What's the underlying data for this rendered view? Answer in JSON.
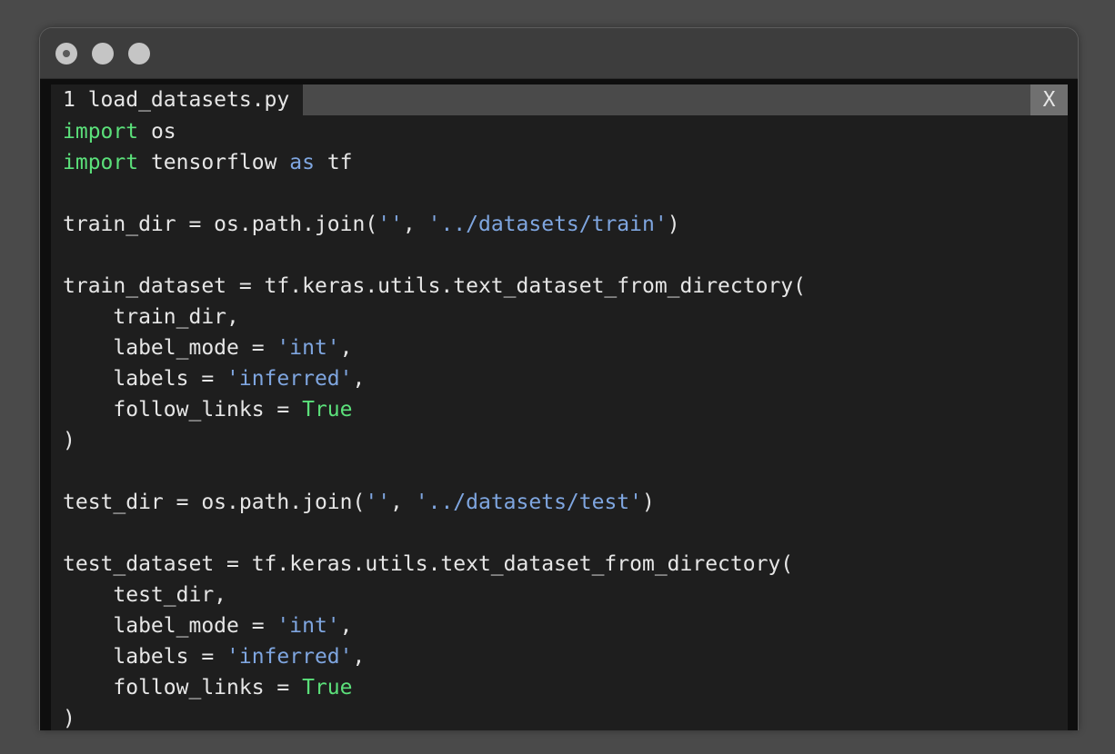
{
  "window": {
    "colors": {
      "background": "#4a4a4a",
      "editor_bg": "#1e1e1e",
      "keyword": "#5be07a",
      "string": "#7fa6e0",
      "text": "#e6e6e6"
    }
  },
  "tab": {
    "label": "1 load_datasets.py",
    "close_label": "X"
  },
  "code": {
    "lines": [
      [
        {
          "t": "import",
          "c": "kw"
        },
        {
          "t": " os"
        }
      ],
      [
        {
          "t": "import",
          "c": "kw"
        },
        {
          "t": " tensorflow "
        },
        {
          "t": "as",
          "c": "str"
        },
        {
          "t": " tf"
        }
      ],
      [],
      [
        {
          "t": "train_dir = os.path.join("
        },
        {
          "t": "''",
          "c": "str"
        },
        {
          "t": ", "
        },
        {
          "t": "'../datasets/train'",
          "c": "str"
        },
        {
          "t": ")"
        }
      ],
      [],
      [
        {
          "t": "train_dataset = tf.keras.utils.text_dataset_from_directory("
        }
      ],
      [
        {
          "t": "    train_dir,"
        }
      ],
      [
        {
          "t": "    label_mode = "
        },
        {
          "t": "'int'",
          "c": "str"
        },
        {
          "t": ","
        }
      ],
      [
        {
          "t": "    labels = "
        },
        {
          "t": "'inferred'",
          "c": "str"
        },
        {
          "t": ","
        }
      ],
      [
        {
          "t": "    follow_links = "
        },
        {
          "t": "True",
          "c": "bool"
        }
      ],
      [
        {
          "t": ")"
        }
      ],
      [],
      [
        {
          "t": "test_dir = os.path.join("
        },
        {
          "t": "''",
          "c": "str"
        },
        {
          "t": ", "
        },
        {
          "t": "'../datasets/test'",
          "c": "str"
        },
        {
          "t": ")"
        }
      ],
      [],
      [
        {
          "t": "test_dataset = tf.keras.utils.text_dataset_from_directory("
        }
      ],
      [
        {
          "t": "    test_dir,"
        }
      ],
      [
        {
          "t": "    label_mode = "
        },
        {
          "t": "'int'",
          "c": "str"
        },
        {
          "t": ","
        }
      ],
      [
        {
          "t": "    labels = "
        },
        {
          "t": "'inferred'",
          "c": "str"
        },
        {
          "t": ","
        }
      ],
      [
        {
          "t": "    follow_links = "
        },
        {
          "t": "True",
          "c": "bool"
        }
      ],
      [
        {
          "t": ")"
        }
      ]
    ]
  }
}
